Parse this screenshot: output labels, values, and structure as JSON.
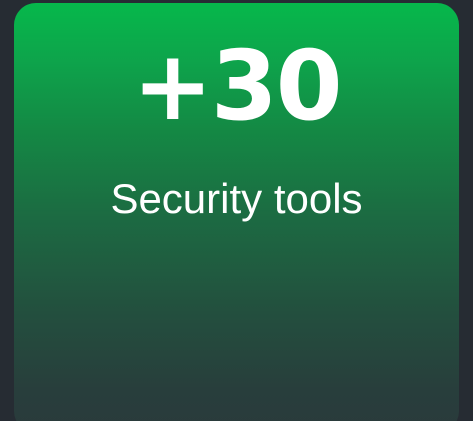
{
  "card": {
    "value": "+30",
    "label": "Security tools"
  },
  "colors": {
    "page_background": "#262c33",
    "card_gradient_top": "#06b84b",
    "card_gradient_bottom": "#2a3a3b",
    "text": "#ffffff"
  }
}
